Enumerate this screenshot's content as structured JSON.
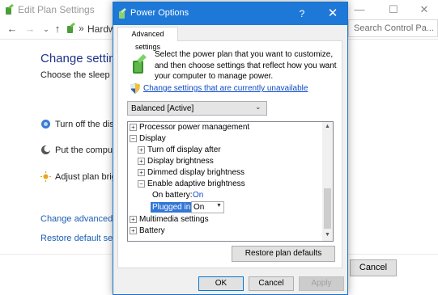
{
  "background_window": {
    "title": "Edit Plan Settings",
    "address_sep": "»",
    "address_text": "Hardwa",
    "search_placeholder": "Search Control Pa...",
    "heading": "Change settings",
    "subheading": "Choose the sleep and",
    "rows": [
      {
        "label": "Turn off the displa"
      },
      {
        "label": "Put the computer"
      },
      {
        "label": "Adjust plan bright"
      }
    ],
    "links": [
      "Change advanced pov",
      "Restore default setting"
    ],
    "cancel_label": "Cancel"
  },
  "dialog": {
    "title": "Power Options",
    "help_glyph": "?",
    "close_glyph": "✕",
    "tab_label": "Advanced settings",
    "intro": "Select the power plan that you want to customize, and then choose settings that reflect how you want your computer to manage power.",
    "unavailable_link": "Change settings that are currently unavailable",
    "plan_select": "Balanced [Active]",
    "tree": [
      {
        "exp": "+",
        "label": "Processor power management",
        "level": 0
      },
      {
        "exp": "−",
        "label": "Display",
        "level": 0
      },
      {
        "exp": "+",
        "label": "Turn off display after",
        "level": 1
      },
      {
        "exp": "+",
        "label": "Display brightness",
        "level": 1
      },
      {
        "exp": "+",
        "label": "Dimmed display brightness",
        "level": 1
      },
      {
        "exp": "−",
        "label": "Enable adaptive brightness",
        "level": 1
      },
      {
        "label": "On battery:",
        "value": "On",
        "level": 2
      },
      {
        "label": "Plugged in:",
        "value": "On",
        "level": 2,
        "selected": true
      },
      {
        "exp": "+",
        "label": "Multimedia settings",
        "level": 0
      },
      {
        "exp": "+",
        "label": "Battery",
        "level": 0
      }
    ],
    "restore_label": "Restore plan defaults",
    "ok_label": "OK",
    "cancel_label": "Cancel",
    "apply_label": "Apply"
  },
  "colors": {
    "titlebar": "#1e78d7",
    "link": "#0c49c6",
    "heading": "#1e3287",
    "selection": "#3377d6"
  }
}
